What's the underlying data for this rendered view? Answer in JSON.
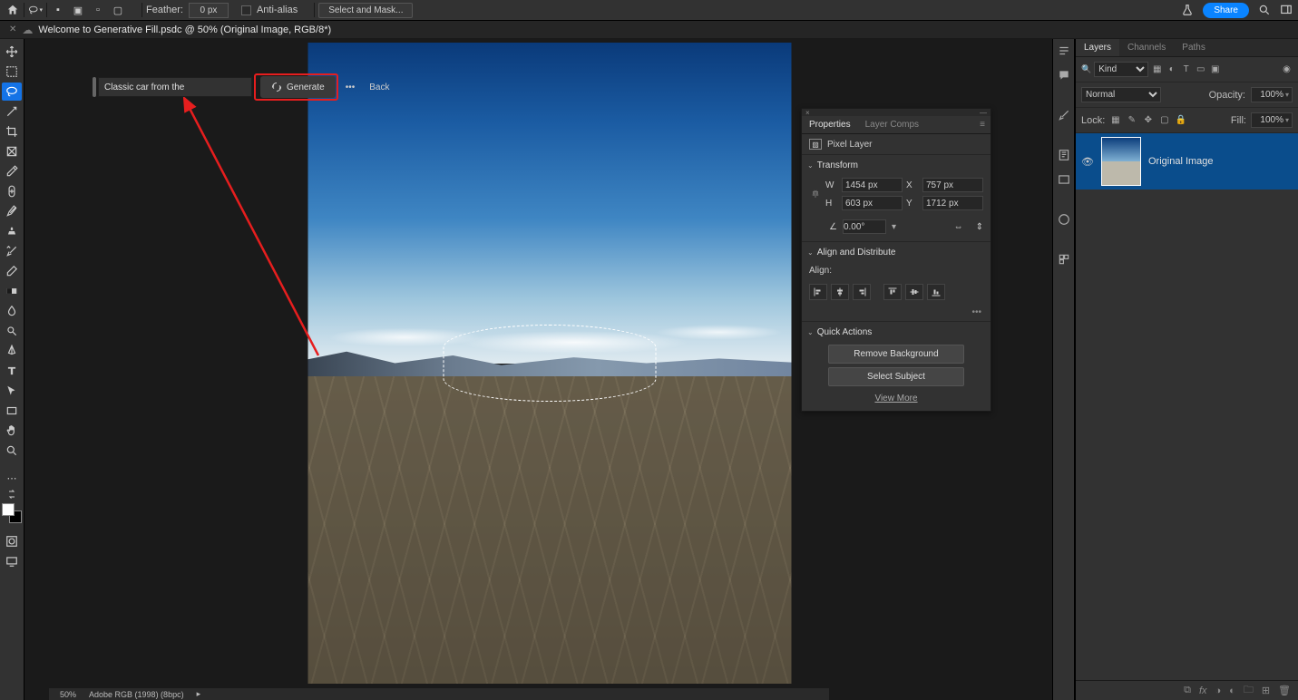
{
  "options": {
    "feather_label": "Feather:",
    "feather_value": "0 px",
    "antialias_label": "Anti-alias",
    "select_mask": "Select and Mask..."
  },
  "share": "Share",
  "doc_title": "Welcome to Generative Fill.psdc @ 50% (Original Image, RGB/8*)",
  "taskbar": {
    "prompt": "Classic car from the",
    "generate": "Generate",
    "back": "Back"
  },
  "properties": {
    "tab_props": "Properties",
    "tab_comps": "Layer Comps",
    "layer_type": "Pixel Layer",
    "transform_hdr": "Transform",
    "W": "1454 px",
    "H": "603 px",
    "X": "757 px",
    "Y": "1712 px",
    "angle": "0.00°",
    "align_hdr": "Align and Distribute",
    "align_label": "Align:",
    "quick_hdr": "Quick Actions",
    "remove_bg": "Remove Background",
    "select_subject": "Select Subject",
    "view_more": "View More"
  },
  "layers": {
    "tab_layers": "Layers",
    "tab_channels": "Channels",
    "tab_paths": "Paths",
    "filter_kind_prefix": "Kind",
    "blend_mode": "Normal",
    "opacity_label": "Opacity:",
    "opacity_value": "100%",
    "lock_label": "Lock:",
    "fill_label": "Fill:",
    "fill_value": "100%",
    "layer_name": "Original Image"
  },
  "status": {
    "zoom": "50%",
    "profile": "Adobe RGB (1998) (8bpc)"
  }
}
